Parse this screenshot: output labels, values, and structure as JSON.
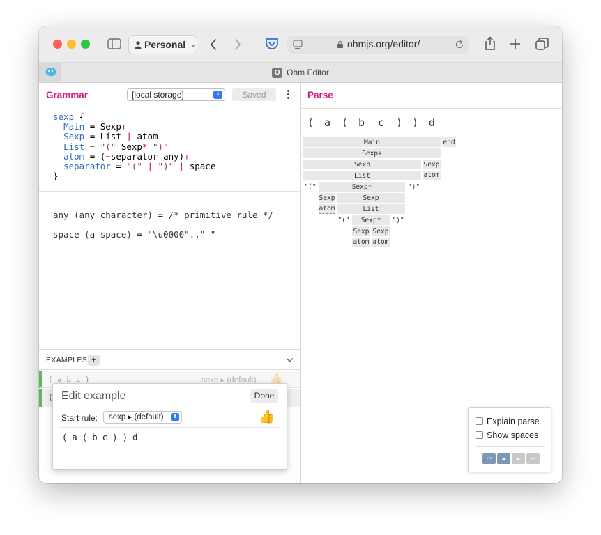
{
  "browser": {
    "profile": "Personal",
    "url": "ohmjs.org/editor/",
    "tab_title": "Ohm Editor",
    "tab_favicon_letter": "O"
  },
  "grammar": {
    "title": "Grammar",
    "storage_select": "[local storage]",
    "saved_label": "Saved",
    "builtin_lines": [
      "any (any character) = /* primitive rule */",
      "space (a space) = \"\\u0000\"..\" \""
    ]
  },
  "examples": {
    "header": "EXAMPLES",
    "add_label": "+",
    "item1_text": "( a b c )",
    "item1_rule": "sexp ▸ (default)",
    "item2_text": "("
  },
  "edit_example": {
    "title": "Edit example",
    "done_label": "Done",
    "start_rule_label": "Start rule:",
    "start_rule_value": "sexp ▸ (default)",
    "thumb": "👍",
    "text": "( a ( b c ) ) d"
  },
  "parse": {
    "title": "Parse",
    "input_chars": [
      "(",
      "a",
      "(",
      "b",
      "c",
      ")",
      ")",
      "d"
    ],
    "tree": {
      "main": "Main",
      "end": "end",
      "sexp_plus": "Sexp+",
      "sexp": "Sexp",
      "list": "List",
      "atom": "atom",
      "lparen": "\"(\"",
      "rparen": "\")\"",
      "sexp_star": "Sexp*"
    },
    "explain_parse": "Explain parse",
    "show_spaces": "Show spaces"
  }
}
